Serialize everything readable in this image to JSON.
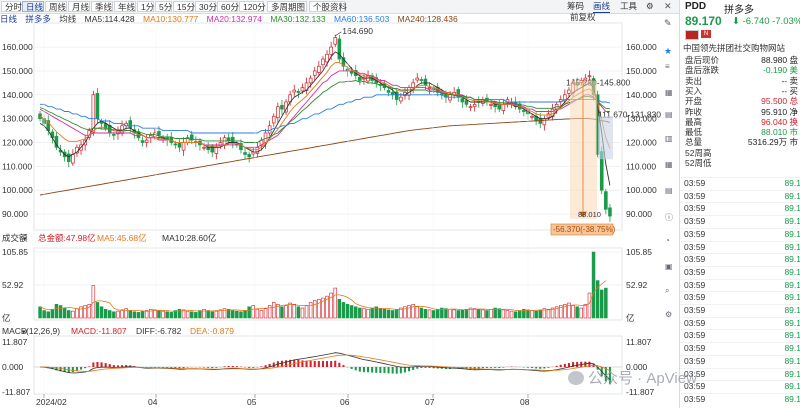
{
  "toolbar": {
    "periods": [
      "分时",
      "日线",
      "周线",
      "月线",
      "季线",
      "年线",
      "1分",
      "5分",
      "15分",
      "30分",
      "60分",
      "120分"
    ],
    "active": "日线",
    "extras": [
      "多周期图",
      "个股资料"
    ],
    "right": [
      "筹码",
      "画线",
      "工具"
    ]
  },
  "ma": {
    "label": "日线",
    "name": "拼多多",
    "title": "均线",
    "ma5": "MA5:114.428",
    "ma10": "MA10:130.777",
    "ma20": "MA20:132.974",
    "ma30": "MA30:132.133",
    "ma60": "MA60:136.503",
    "ma240": "MA240:128.436",
    "restore": "前复权"
  },
  "colors": {
    "up": "#d0202a",
    "down": "#1a9a4a",
    "ma5": "#333333",
    "ma10": "#e07a1e",
    "ma20": "#d22fa8",
    "ma30": "#2e8b2e",
    "ma60": "#2a7de1",
    "ma240": "#8b4513"
  },
  "chart_data": {
    "type": "candlestick",
    "price_axis": [
      "160.000",
      "150.000",
      "140.000",
      "130.000",
      "120.000",
      "110.000",
      "100.000",
      "90.000"
    ],
    "price_range": [
      85,
      168
    ],
    "x_ticks": [
      "2024/02",
      "04",
      "05",
      "06",
      "07",
      "08"
    ],
    "high_label": "164.690",
    "recent_high_label": "145.280",
    "recent_high_label_2": "145.800",
    "mid_label": "111.670",
    "mid_label_2": "131.830",
    "low_label": "88.010",
    "drop_label": "-56.370(-38.75%)",
    "closes": [
      130,
      128,
      125,
      122,
      118,
      116,
      114,
      112,
      115,
      118,
      119,
      121,
      125,
      140,
      130,
      128,
      126,
      124,
      123,
      125,
      127,
      128,
      126,
      124,
      122,
      120,
      121,
      123,
      124,
      123,
      122,
      121,
      120,
      119,
      118,
      120,
      122,
      121,
      120,
      119,
      118,
      117,
      116,
      118,
      120,
      122,
      121,
      120,
      119,
      117,
      115,
      114,
      116,
      118,
      121,
      124,
      127,
      131,
      135,
      134,
      137,
      140,
      142,
      141,
      143,
      145,
      147,
      150,
      152,
      155,
      157,
      160,
      164,
      155,
      152,
      150,
      149,
      148,
      146,
      147,
      148,
      146,
      145,
      144,
      143,
      141,
      140,
      138,
      139,
      141,
      143,
      145,
      147,
      146,
      144,
      143,
      142,
      141,
      140,
      139,
      140,
      141,
      139,
      137,
      136,
      135,
      136,
      137,
      138,
      137,
      136,
      135,
      134,
      136,
      138,
      137,
      135,
      134,
      133,
      132,
      131,
      129,
      128,
      130,
      132,
      134,
      136,
      138,
      140,
      142,
      145,
      144,
      146,
      147,
      148,
      140,
      115,
      100,
      92,
      89.17
    ],
    "ma_lines": {
      "MA5": [
        128,
        127,
        125,
        122,
        119,
        117,
        115,
        114,
        115,
        116,
        118,
        120,
        123,
        126,
        128,
        129,
        128,
        127,
        126,
        125,
        125,
        126,
        126,
        125,
        124,
        123,
        122,
        122,
        122,
        122,
        122,
        121,
        121,
        120,
        120,
        120,
        120,
        120,
        120,
        120,
        119,
        118,
        118,
        118,
        118,
        119,
        120,
        120,
        120,
        119,
        118,
        117,
        116,
        116,
        117,
        119,
        122,
        125,
        128,
        131,
        134,
        137,
        139,
        140,
        141,
        142,
        144,
        146,
        148,
        150,
        153,
        156,
        158,
        157,
        155,
        153,
        151,
        149,
        148,
        147,
        147,
        147,
        146,
        145,
        144,
        143,
        142,
        140,
        140,
        140,
        141,
        142,
        144,
        145,
        145,
        145,
        144,
        143,
        142,
        141,
        141,
        140,
        140,
        139,
        138,
        137,
        137,
        137,
        137,
        137,
        137,
        136,
        136,
        136,
        136,
        136,
        135,
        135,
        134,
        133,
        132,
        131,
        130,
        130,
        130,
        131,
        133,
        135,
        137,
        139,
        141,
        142,
        143,
        144,
        145,
        143,
        136,
        124,
        111,
        102
      ],
      "MA20": [
        134,
        133,
        132,
        131,
        130,
        129,
        128,
        127,
        126,
        125,
        124,
        123,
        123,
        124,
        124,
        124,
        124,
        124,
        124,
        124,
        124,
        124,
        124,
        123,
        123,
        123,
        122,
        122,
        122,
        121,
        121,
        121,
        121,
        120,
        120,
        120,
        120,
        120,
        120,
        120,
        119,
        119,
        119,
        119,
        119,
        119,
        119,
        119,
        119,
        119,
        118,
        118,
        118,
        118,
        119,
        120,
        121,
        122,
        123,
        125,
        127,
        129,
        131,
        133,
        135,
        137,
        139,
        141,
        143,
        145,
        146,
        148,
        149,
        150,
        150,
        150,
        150,
        150,
        149,
        149,
        148,
        148,
        147,
        146,
        146,
        145,
        144,
        144,
        143,
        143,
        143,
        143,
        143,
        143,
        143,
        142,
        142,
        142,
        141,
        141,
        141,
        140,
        140,
        140,
        139,
        139,
        138,
        138,
        138,
        137,
        137,
        137,
        136,
        136,
        136,
        136,
        136,
        135,
        135,
        134,
        134,
        133,
        133,
        133,
        133,
        133,
        134,
        134,
        135,
        136,
        137,
        138,
        139,
        140,
        140,
        139,
        137,
        135,
        133,
        133
      ],
      "MA60": [
        136,
        136,
        135,
        135,
        134,
        134,
        133,
        133,
        132,
        132,
        131,
        131,
        130,
        130,
        130,
        129,
        129,
        129,
        128,
        128,
        128,
        127,
        127,
        127,
        127,
        126,
        126,
        126,
        126,
        126,
        125,
        125,
        125,
        125,
        125,
        125,
        125,
        124,
        124,
        124,
        124,
        124,
        124,
        124,
        124,
        124,
        124,
        124,
        124,
        124,
        124,
        124,
        124,
        124,
        125,
        125,
        125,
        126,
        126,
        127,
        127,
        128,
        128,
        129,
        130,
        130,
        131,
        132,
        132,
        133,
        134,
        134,
        135,
        136,
        136,
        137,
        137,
        138,
        138,
        139,
        139,
        139,
        140,
        140,
        140,
        140,
        140,
        140,
        140,
        140,
        140,
        140,
        140,
        140,
        140,
        140,
        140,
        140,
        140,
        139,
        139,
        139,
        139,
        139,
        139,
        139,
        138,
        138,
        138,
        138,
        138,
        138,
        138,
        138,
        137,
        137,
        137,
        137,
        137,
        137,
        137,
        137,
        137,
        137,
        137,
        137,
        137,
        137,
        138,
        138,
        138,
        138,
        138,
        138,
        138,
        138,
        138,
        137,
        137,
        136.5
      ],
      "MA240": [
        98,
        98.3,
        98.6,
        98.9,
        99.2,
        99.5,
        99.8,
        100.1,
        100.4,
        100.7,
        101,
        101.3,
        101.6,
        101.9,
        102.2,
        102.5,
        102.8,
        103.1,
        103.4,
        103.7,
        104,
        104.3,
        104.6,
        104.9,
        105.2,
        105.5,
        105.8,
        106.1,
        106.4,
        106.7,
        107,
        107.3,
        107.6,
        107.9,
        108.2,
        108.5,
        108.8,
        109.1,
        109.4,
        109.7,
        110,
        110.3,
        110.6,
        110.9,
        111.2,
        111.5,
        111.8,
        112.1,
        112.4,
        112.7,
        113,
        113.3,
        113.6,
        113.9,
        114.2,
        114.5,
        114.8,
        115.1,
        115.4,
        115.7,
        116,
        116.3,
        116.6,
        116.9,
        117.2,
        117.5,
        117.8,
        118.1,
        118.4,
        118.7,
        119,
        119.3,
        119.6,
        119.9,
        120.2,
        120.5,
        120.8,
        121.1,
        121.4,
        121.7,
        122,
        122.3,
        122.6,
        122.9,
        123.2,
        123.5,
        123.8,
        124.1,
        124.4,
        124.7,
        125,
        125.2,
        125.4,
        125.6,
        125.8,
        126,
        126.2,
        126.4,
        126.6,
        126.8,
        127,
        127.1,
        127.2,
        127.3,
        127.4,
        127.5,
        127.6,
        127.7,
        127.8,
        127.9,
        128,
        128.1,
        128.2,
        128.3,
        128.4,
        128.5,
        128.6,
        128.7,
        128.8,
        128.9,
        129,
        129.1,
        129.2,
        129.3,
        129.4,
        129.5,
        129.6,
        129.7,
        129.8,
        129.9,
        130,
        130.1,
        130.1,
        130.1,
        130,
        129.8,
        129.5,
        129.2,
        128.9,
        128.436
      ]
    },
    "volume": {
      "title": "成交额",
      "total": "总金额:47.98亿",
      "ma5": "MA5:45.68亿",
      "ma10": "MA10:28.60亿",
      "axis": [
        "105.85",
        "52.92",
        "亿"
      ],
      "range": [
        0,
        105.85
      ],
      "values": [
        18,
        12,
        10,
        14,
        22,
        20,
        16,
        12,
        11,
        15,
        18,
        20,
        22,
        52,
        25,
        18,
        14,
        12,
        10,
        11,
        13,
        15,
        12,
        10,
        9,
        11,
        12,
        14,
        13,
        12,
        11,
        10,
        9,
        12,
        14,
        13,
        11,
        10,
        9,
        12,
        14,
        12,
        10,
        11,
        13,
        15,
        14,
        12,
        11,
        10,
        12,
        18,
        20,
        14,
        12,
        15,
        20,
        25,
        22,
        18,
        20,
        24,
        22,
        18,
        16,
        20,
        25,
        28,
        30,
        32,
        35,
        40,
        48,
        30,
        25,
        22,
        20,
        18,
        16,
        15,
        14,
        16,
        18,
        15,
        14,
        13,
        12,
        14,
        16,
        18,
        20,
        22,
        18,
        16,
        14,
        13,
        12,
        14,
        16,
        15,
        14,
        13,
        12,
        13,
        14,
        16,
        15,
        14,
        13,
        12,
        14,
        16,
        15,
        13,
        12,
        11,
        10,
        12,
        14,
        13,
        12,
        11,
        13,
        15,
        14,
        16,
        18,
        20,
        22,
        24,
        20,
        18,
        16,
        22,
        40,
        105.85,
        60,
        45,
        47.98
      ]
    },
    "macd": {
      "title": "MACD",
      "params": "(12,26,9)",
      "macd_label": "MACD:-11.807",
      "diff_label": "DIFF:-6.782",
      "dea_label": "DEA:-0.879",
      "axis": [
        "11.807",
        "0.000",
        "-11.807"
      ],
      "range": [
        -11.807,
        11.807
      ]
    }
  },
  "panel": {
    "symbol": "PDD",
    "name": "拼多多",
    "price": "89.170",
    "change": "-6.740",
    "change_pct": "-7.03%",
    "company": "中国领先拼团社交购物网站",
    "rows": [
      {
        "k": "盘后现价",
        "v": "88.980 盘"
      },
      {
        "k": "盘后涨跌",
        "v": "-0.190 美"
      },
      {
        "k": "卖出",
        "v": "-- 卖"
      },
      {
        "k": "买入",
        "v": "-- 买"
      },
      {
        "k": "开盘",
        "v": "95.500 总"
      },
      {
        "k": "昨收",
        "v": "95.910 净"
      },
      {
        "k": "最高",
        "v": "96.040 换"
      },
      {
        "k": "最低",
        "v": "88.010 市"
      },
      {
        "k": "总量",
        "v": "5316.29万 市"
      },
      {
        "k": "52周高",
        "v": ""
      },
      {
        "k": "52周低",
        "v": ""
      }
    ],
    "ticks": [
      "03:59",
      "03:59",
      "03:59",
      "03:59",
      "03:59",
      "03:59",
      "03:59",
      "03:59",
      "03:59",
      "03:59",
      "03:59",
      "03:59",
      "03:59",
      "03:59",
      "03:59",
      "03:59",
      "03:59",
      "03:59"
    ],
    "tick_price": "89.1"
  },
  "watermark": "公众号 · ApView"
}
